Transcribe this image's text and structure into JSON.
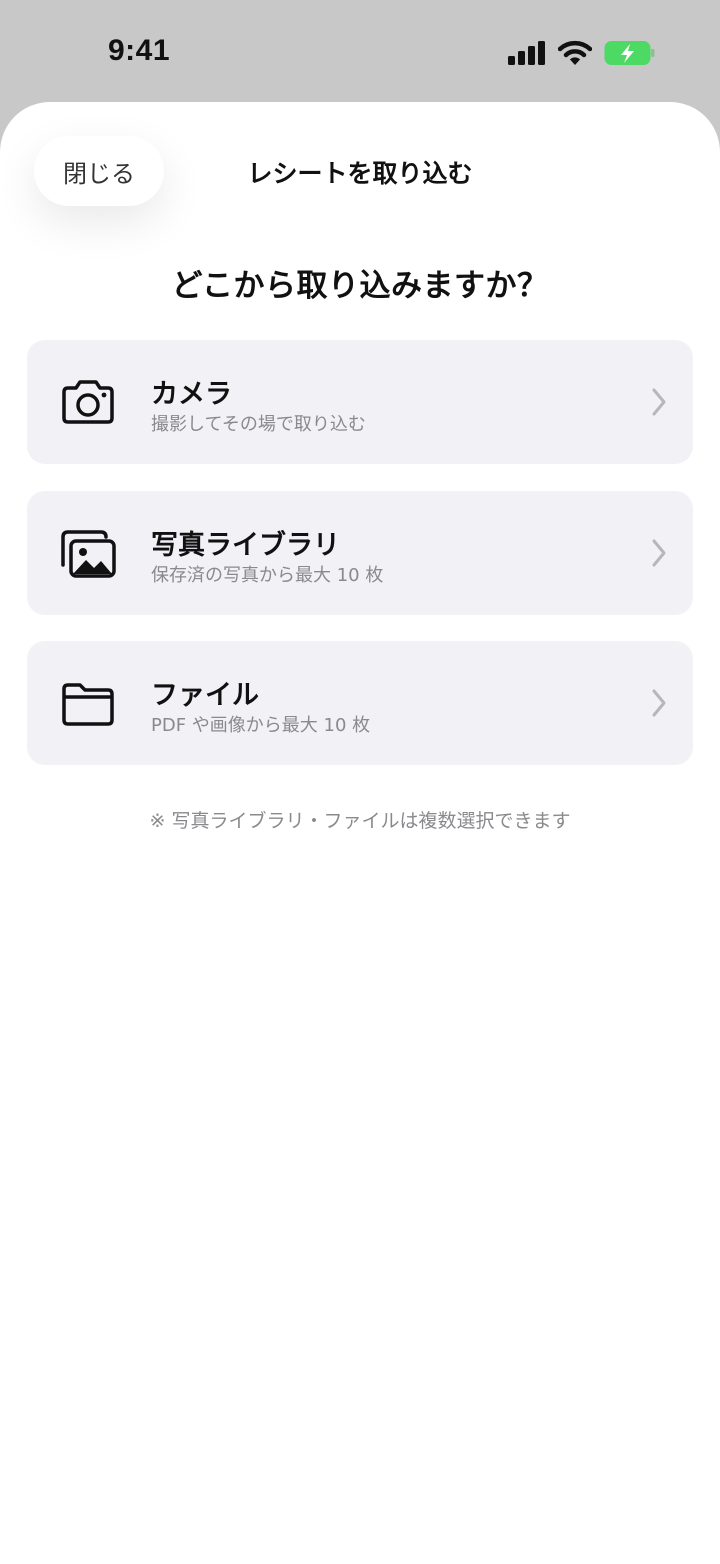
{
  "status": {
    "time": "9:41",
    "icons": [
      "signal-icon",
      "wifi-icon",
      "battery-charging-icon"
    ],
    "battery_color": "#4cd964"
  },
  "sheet": {
    "close_label": "閉じる",
    "title": "レシートを取り込む",
    "question": "どこから取り込みますか？",
    "options": [
      {
        "icon": "camera-icon",
        "title": "カメラ",
        "subtitle": "撮影してその場で取り込む"
      },
      {
        "icon": "photo-library-icon",
        "title": "写真ライブラリ",
        "subtitle": "保存済の写真から最大 10 枚"
      },
      {
        "icon": "folder-icon",
        "title": "ファイル",
        "subtitle": "PDF や画像から最大 10 枚"
      }
    ],
    "note": "※ 写真ライブラリ・ファイルは複数選択できます"
  },
  "colors": {
    "sheet_background": "#ffffff",
    "option_background": "#f1f1f6",
    "secondary_text": "#8a8a8e",
    "backdrop": "#c8c8c8"
  }
}
